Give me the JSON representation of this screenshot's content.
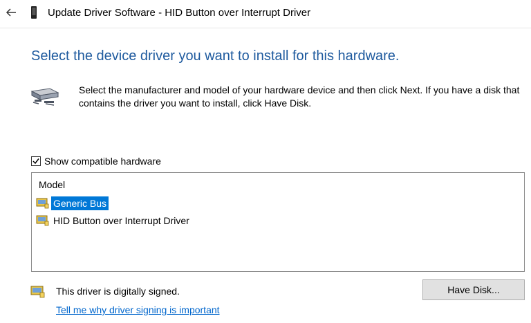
{
  "titlebar": {
    "title": "Update Driver Software - HID Button over Interrupt Driver",
    "back_icon": "back-arrow-icon",
    "device_icon": "device-icon"
  },
  "main": {
    "heading": "Select the device driver you want to install for this hardware.",
    "instructions": "Select the manufacturer and model of your hardware device and then click Next. If you have a disk that contains the driver you want to install, click Have Disk.",
    "show_compatible": {
      "label": "Show compatible hardware",
      "checked": true
    },
    "model_list": {
      "header": "Model",
      "items": [
        {
          "label": "Generic Bus",
          "selected": true
        },
        {
          "label": "HID Button over Interrupt Driver",
          "selected": false
        }
      ]
    },
    "signed_text": "This driver is digitally signed.",
    "signing_link": "Tell me why driver signing is important",
    "have_disk_label": "Have Disk..."
  },
  "colors": {
    "heading": "#1e5a9e",
    "link": "#0066cc",
    "selection": "#0078d7"
  }
}
